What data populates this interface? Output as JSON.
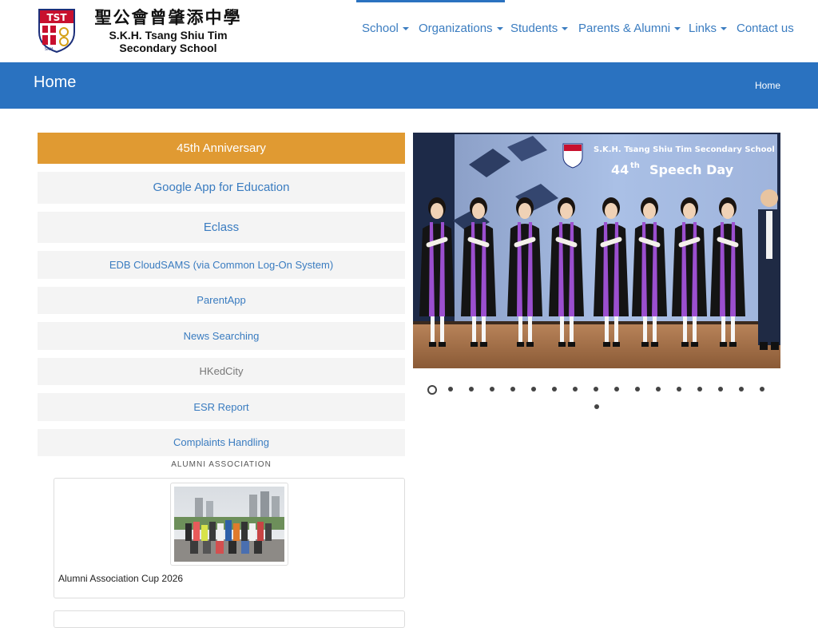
{
  "header": {
    "school_name_cn": "聖公會曾肇添中學",
    "school_name_en_1": "S.K.H. Tsang Shiu Tim",
    "school_name_en_2": "Secondary School",
    "logo_text_1": "TST",
    "logo_text_2": "SKH",
    "nav": [
      {
        "label": "School",
        "dropdown": true
      },
      {
        "label": "Organizations",
        "dropdown": true
      },
      {
        "label": "Students",
        "dropdown": true
      },
      {
        "label": "Parents & Alumni",
        "dropdown": true
      },
      {
        "label": "Links",
        "dropdown": true
      },
      {
        "label": "Contact us",
        "dropdown": false
      }
    ]
  },
  "title_bar": {
    "title": "Home",
    "breadcrumb": "Home"
  },
  "links": [
    {
      "label": "45th Anniversary"
    },
    {
      "label": "Google App for Education"
    },
    {
      "label": "Eclass"
    },
    {
      "label": "EDB CloudSAMS (via Common Log-On System)"
    },
    {
      "label": "ParentApp"
    },
    {
      "label": "News Searching"
    },
    {
      "label": "HKedCity"
    },
    {
      "label": "ESR Report"
    },
    {
      "label": "Complaints Handling"
    }
  ],
  "alumni": {
    "section_label": "ALUMNI ASSOCIATION",
    "caption": "Alumni Association Cup 2026"
  },
  "slider": {
    "banner_school": "S.K.H. Tsang Shiu Tim Secondary School",
    "banner_event_num": "44",
    "banner_event_sup": "th",
    "banner_event": "Speech Day",
    "slide_count": 18,
    "active_slide": 1
  },
  "colors": {
    "brand_blue": "#2a72c0",
    "link_blue": "#3a7cc0",
    "anniversary_orange": "#e09a32",
    "button_bg": "#f4f4f4"
  }
}
